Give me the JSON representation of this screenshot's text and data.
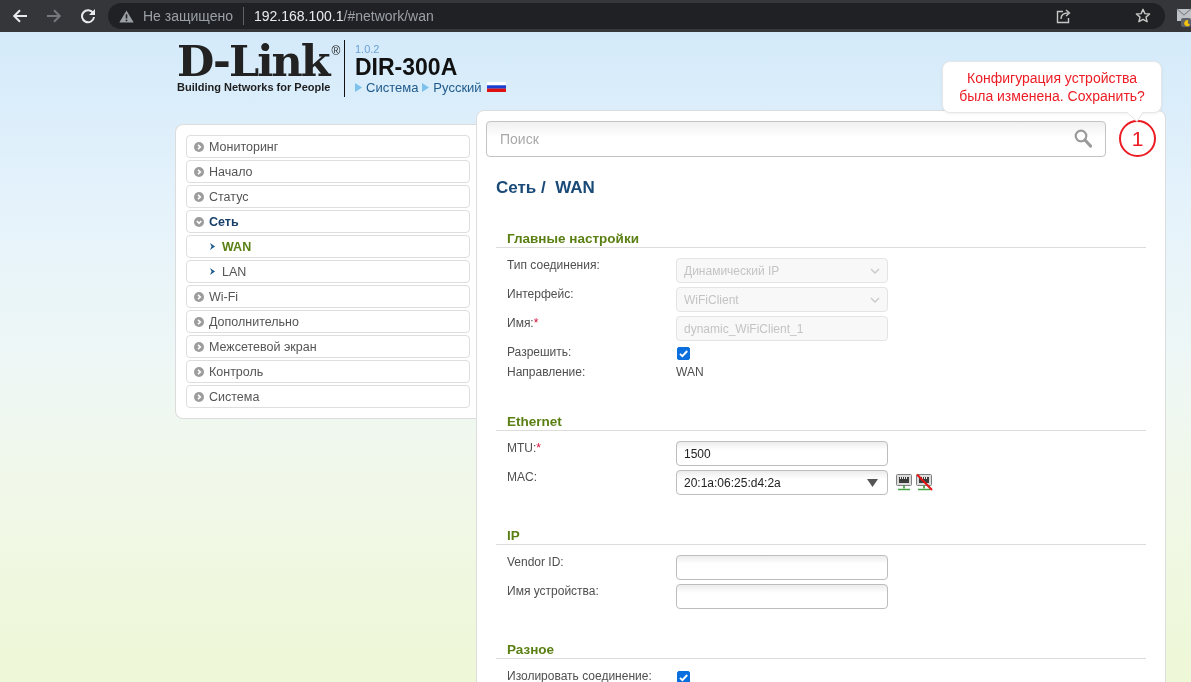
{
  "browser": {
    "nav_buttons": [
      {
        "kind": "back",
        "disabled": false
      },
      {
        "kind": "forward",
        "disabled": true
      },
      {
        "kind": "reload",
        "disabled": false
      }
    ],
    "security_label": "Не защищено",
    "url": {
      "host": "192.168.100.1",
      "path": "/#network/wan"
    }
  },
  "header": {
    "logo": {
      "wordmark": "D-Link",
      "registered": "®",
      "tagline": "Building Networks for People"
    },
    "version": "1.0.2",
    "model": "DIR-300A",
    "links": [
      {
        "label": "Система",
        "flag": false
      },
      {
        "label": "Русский",
        "flag": true
      }
    ]
  },
  "notification": {
    "message": "Конфигурация устройства была изменена. Сохранить?",
    "count": "1"
  },
  "search": {
    "placeholder": "Поиск"
  },
  "sidebar": {
    "items": [
      {
        "label": "Мониторинг",
        "expanded": false,
        "selected": false
      },
      {
        "label": "Начало",
        "expanded": false,
        "selected": false
      },
      {
        "label": "Статус",
        "expanded": false,
        "selected": false
      },
      {
        "label": "Сеть",
        "expanded": true,
        "selected": false,
        "children": [
          {
            "label": "WAN",
            "selected": true
          },
          {
            "label": "LAN",
            "selected": false
          }
        ]
      },
      {
        "label": "Wi-Fi",
        "expanded": false,
        "selected": false
      },
      {
        "label": "Дополнительно",
        "expanded": false,
        "selected": false
      },
      {
        "label": "Межсетевой экран",
        "expanded": false,
        "selected": false
      },
      {
        "label": "Контроль",
        "expanded": false,
        "selected": false
      },
      {
        "label": "Система",
        "expanded": false,
        "selected": false
      }
    ]
  },
  "page_title": "Сеть /  WAN",
  "sections": [
    {
      "title": "Главные настройки",
      "fields": [
        {
          "kind": "select",
          "label": "Тип соединения:",
          "value": "Динамический IP",
          "disabled": true
        },
        {
          "kind": "select",
          "label": "Интерфейс:",
          "value": "WiFiClient",
          "disabled": true
        },
        {
          "kind": "input",
          "label": "Имя:",
          "required_mark": "*",
          "value": "dynamic_WiFiClient_1",
          "disabled": true
        },
        {
          "kind": "checkbox",
          "label": "Разрешить:",
          "checked": true
        },
        {
          "kind": "text",
          "label": "Направление:",
          "value": "WAN"
        }
      ]
    },
    {
      "title": "Ethernet",
      "fields": [
        {
          "kind": "input",
          "label": "MTU:",
          "required_mark": "*",
          "value": "1500",
          "disabled": false
        },
        {
          "kind": "combo",
          "label": "MAC:",
          "value": "20:1a:06:25:d4:2a",
          "disabled": false,
          "actions": [
            {
              "kind": "port"
            },
            {
              "kind": "port_off"
            }
          ]
        }
      ]
    },
    {
      "title": "IP",
      "fields": [
        {
          "kind": "input",
          "label": "Vendor ID:",
          "disabled": false
        },
        {
          "kind": "input",
          "label": "Имя устройства:",
          "disabled": false
        }
      ]
    },
    {
      "title": "Разное",
      "fields": [
        {
          "kind": "checkbox",
          "label": "Изолировать соединение:",
          "checked": true
        }
      ]
    }
  ]
}
